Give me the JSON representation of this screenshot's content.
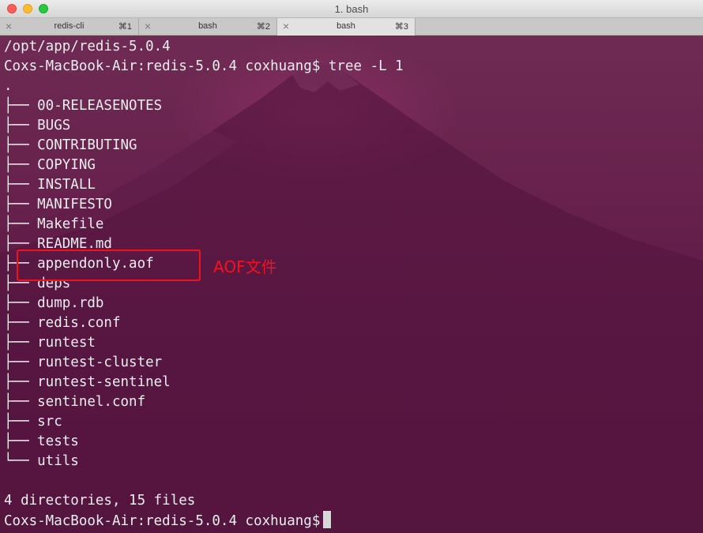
{
  "window": {
    "title": "1. bash",
    "background_color": "#5e1f48",
    "text_color": "#eeeeee",
    "annotation_color": "#f3121c"
  },
  "tabs": [
    {
      "label": "redis-cli",
      "shortcut": "⌘1",
      "close_icon": "×",
      "active": false
    },
    {
      "label": "bash",
      "shortcut": "⌘2",
      "close_icon": "×",
      "active": false
    },
    {
      "label": "bash",
      "shortcut": "⌘3",
      "close_icon": "×",
      "active": true
    }
  ],
  "terminal": {
    "lines": [
      "/opt/app/redis-5.0.4",
      "Coxs-MacBook-Air:redis-5.0.4 coxhuang$ tree -L 1",
      ".",
      "├── 00-RELEASENOTES",
      "├── BUGS",
      "├── CONTRIBUTING",
      "├── COPYING",
      "├── INSTALL",
      "├── MANIFESTO",
      "├── Makefile",
      "├── README.md",
      "├── appendonly.aof",
      "├── deps",
      "├── dump.rdb",
      "├── redis.conf",
      "├── runtest",
      "├── runtest-cluster",
      "├── runtest-sentinel",
      "├── sentinel.conf",
      "├── src",
      "├── tests",
      "└── utils",
      "",
      "4 directories, 15 files"
    ],
    "prompt": "Coxs-MacBook-Air:redis-5.0.4 coxhuang$"
  },
  "annotation": {
    "label": "AOF文件"
  }
}
